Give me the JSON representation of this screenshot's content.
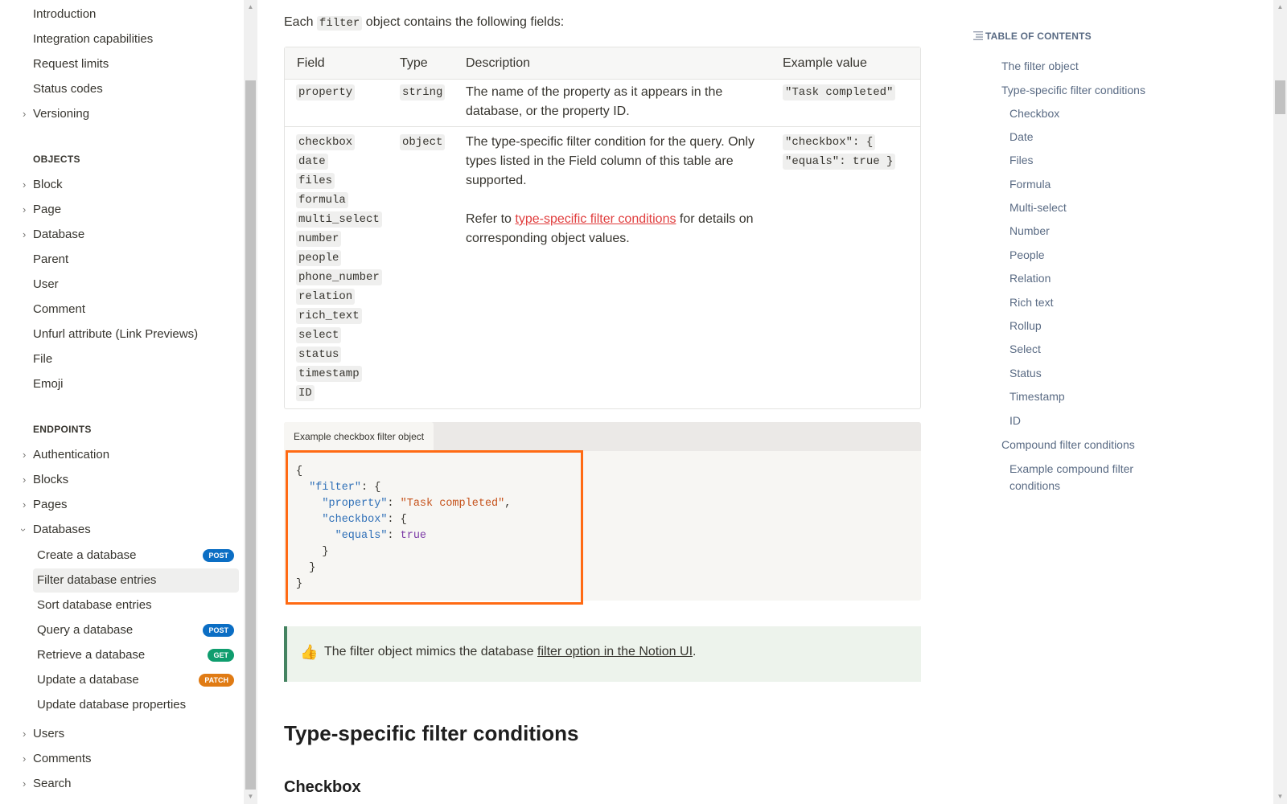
{
  "sidebar": {
    "top_items": [
      {
        "label": "Introduction"
      },
      {
        "label": "Integration capabilities"
      },
      {
        "label": "Request limits"
      },
      {
        "label": "Status codes"
      },
      {
        "label": "Versioning"
      }
    ],
    "objects_heading": "OBJECTS",
    "objects": [
      {
        "label": "Block"
      },
      {
        "label": "Page"
      },
      {
        "label": "Database"
      },
      {
        "label": "Parent"
      },
      {
        "label": "User"
      },
      {
        "label": "Comment"
      },
      {
        "label": "Unfurl attribute (Link Previews)"
      },
      {
        "label": "File"
      },
      {
        "label": "Emoji"
      }
    ],
    "endpoints_heading": "ENDPOINTS",
    "endpoints": [
      {
        "label": "Authentication"
      },
      {
        "label": "Blocks"
      },
      {
        "label": "Pages"
      },
      {
        "label": "Databases"
      }
    ],
    "database_endpoints": [
      {
        "label": "Create a database",
        "badge": "POST"
      },
      {
        "label": "Filter database entries"
      },
      {
        "label": "Sort database entries"
      },
      {
        "label": "Query a database",
        "badge": "POST"
      },
      {
        "label": "Retrieve a database",
        "badge": "GET"
      },
      {
        "label": "Update a database",
        "badge": "PATCH"
      },
      {
        "label": "Update database properties"
      }
    ],
    "bottom_items": [
      {
        "label": "Users"
      },
      {
        "label": "Comments"
      },
      {
        "label": "Search"
      }
    ]
  },
  "main": {
    "intro_prefix": "Each",
    "intro_code": "filter",
    "intro_suffix": "object contains the following fields:",
    "table": {
      "headers": [
        "Field",
        "Type",
        "Description",
        "Example value"
      ],
      "row1": {
        "field": "property",
        "type": "string",
        "description_line1": "The name of the property as it appears in the",
        "description_line2": "database, or the property ID.",
        "example": "\"Task completed\""
      },
      "row2": {
        "fields": [
          "checkbox",
          "date",
          "files",
          "formula",
          "multi_select",
          "number",
          "people",
          "phone_number",
          "relation",
          "rich_text",
          "select",
          "status",
          "timestamp",
          "ID"
        ],
        "type": "object",
        "description_line1": "The type-specific filter condition for the query. Only",
        "description_line2": "types listed in the Field column of this table are",
        "description_line3": "supported.",
        "refer_prefix": "Refer to",
        "refer_link": "type-specific filter conditions",
        "refer_suffix": "for details on",
        "refer_line2": "corresponding object values.",
        "example_line1": "\"checkbox\": {",
        "example_line2": "\"equals\": true }"
      }
    },
    "code_block": {
      "tab_label": "Example checkbox filter object",
      "lines": {
        "l1": "{",
        "l2_key": "\"filter\"",
        "l2_rest": ": {",
        "l3_key": "\"property\"",
        "l3_colon": ": ",
        "l3_val": "\"Task completed\"",
        "l3_end": ",",
        "l4_key": "\"checkbox\"",
        "l4_rest": ": {",
        "l5_key": "\"equals\"",
        "l5_colon": ": ",
        "l5_val": "true",
        "l6": "}",
        "l7": "}",
        "l8": "}"
      }
    },
    "callout": {
      "emoji": "👍",
      "prefix": "The filter object mimics the database",
      "link": "filter option in the Notion UI",
      "suffix": "."
    },
    "section_title": "Type-specific filter conditions",
    "sub_title": "Checkbox"
  },
  "toc": {
    "header": "TABLE OF CONTENTS",
    "items": [
      {
        "label": "The filter object"
      },
      {
        "label": "Type-specific filter conditions"
      },
      {
        "label": "Checkbox"
      },
      {
        "label": "Date"
      },
      {
        "label": "Files"
      },
      {
        "label": "Formula"
      },
      {
        "label": "Multi-select"
      },
      {
        "label": "Number"
      },
      {
        "label": "People"
      },
      {
        "label": "Relation"
      },
      {
        "label": "Rich text"
      },
      {
        "label": "Rollup"
      },
      {
        "label": "Select"
      },
      {
        "label": "Status"
      },
      {
        "label": "Timestamp"
      },
      {
        "label": "ID"
      },
      {
        "label": "Compound filter conditions"
      },
      {
        "label": "Example compound filter"
      },
      {
        "label": "conditions"
      }
    ]
  },
  "colors": {
    "highlight": "#ff6a13",
    "post": "#0b6ec4",
    "get": "#0f9d6e",
    "patch": "#e07b14",
    "callout_border": "#448361"
  }
}
